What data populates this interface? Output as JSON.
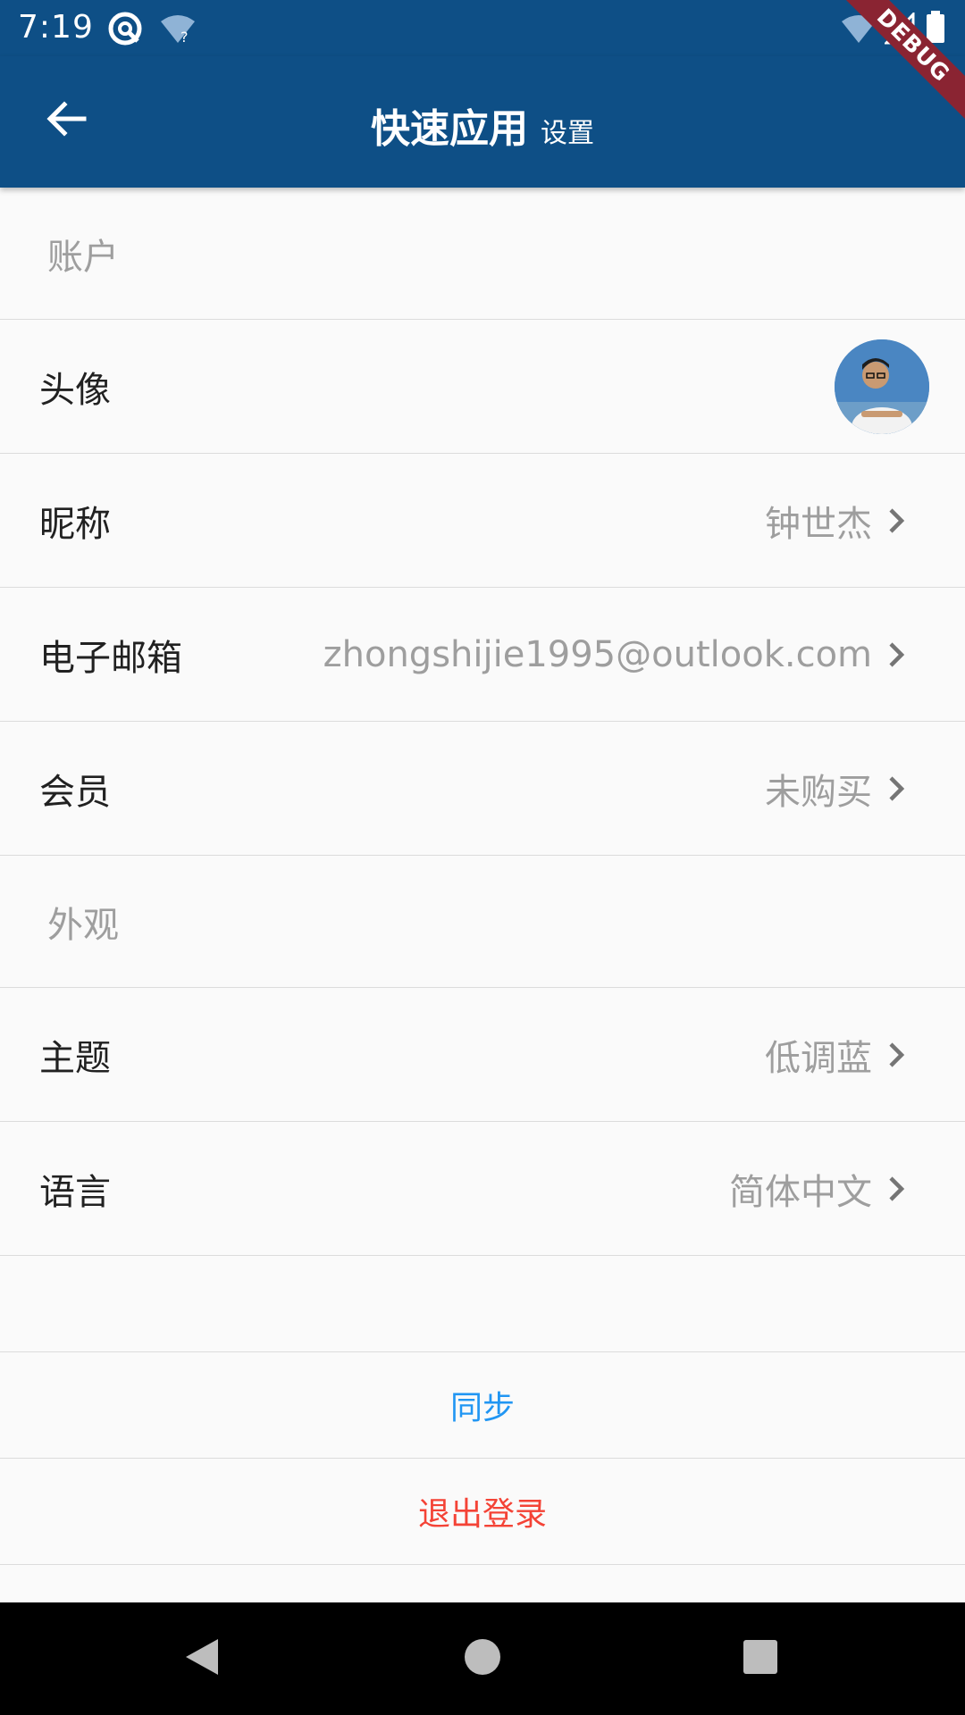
{
  "status_bar": {
    "time": "7:19",
    "icons": [
      "vpn-key-icon",
      "wifi-unknown-icon",
      "wifi-icon",
      "signal-icon",
      "battery-icon"
    ]
  },
  "app_bar": {
    "title": "快速应用",
    "subtitle": "设置",
    "back_icon": "arrow-back-icon",
    "debug_banner": "DEBUG"
  },
  "sections": {
    "account": {
      "header": "账户",
      "avatar_label": "头像",
      "nickname_label": "昵称",
      "nickname_value": "钟世杰",
      "email_label": "电子邮箱",
      "email_value": "zhongshijie1995@outlook.com",
      "member_label": "会员",
      "member_value": "未购买"
    },
    "appearance": {
      "header": "外观",
      "theme_label": "主题",
      "theme_value": "低调蓝",
      "language_label": "语言",
      "language_value": "简体中文"
    }
  },
  "actions": {
    "sync": "同步",
    "logout": "退出登录"
  },
  "colors": {
    "app_bar": "#0e4f86",
    "sync_text": "#2196f3",
    "logout_text": "#f44336",
    "secondary_text": "#9e9e9e"
  }
}
